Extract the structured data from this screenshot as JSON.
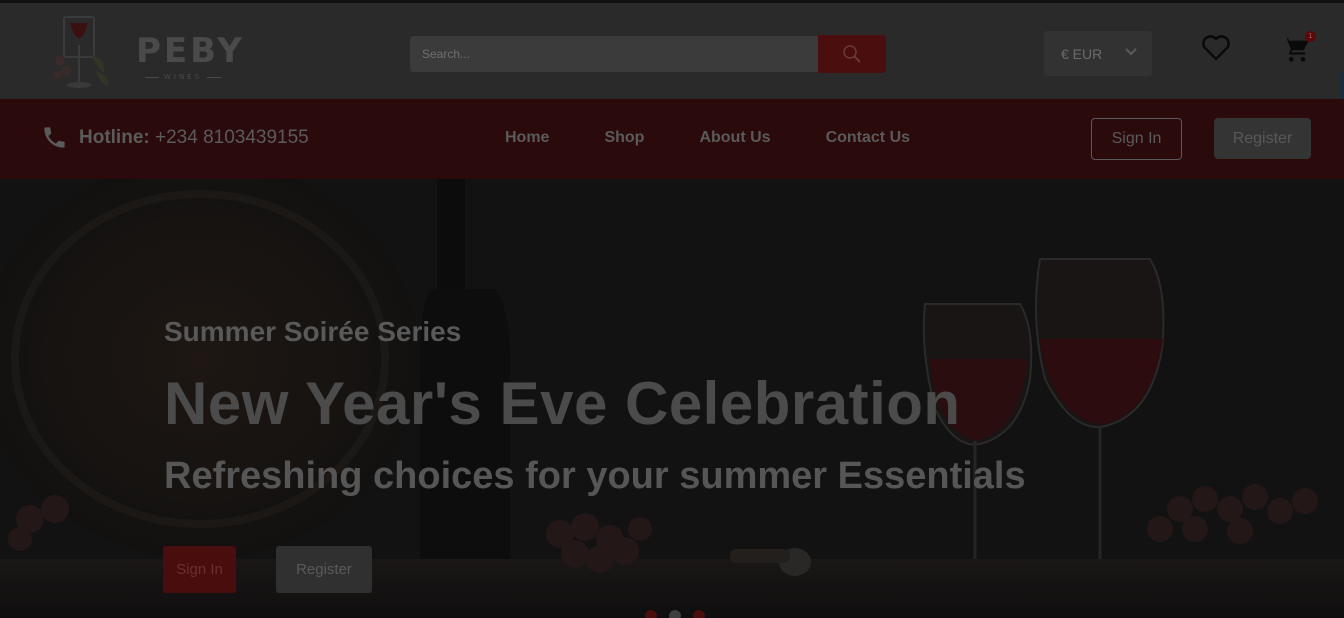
{
  "header": {
    "brand_name": "PEBY",
    "brand_sub": "WINES",
    "search_placeholder": "Search...",
    "currency": "€ EUR",
    "cart_count": "1"
  },
  "nav": {
    "hotline_label": "Hotline:",
    "hotline_number": "+234 8103439155",
    "items": [
      {
        "label": "Home"
      },
      {
        "label": "Shop"
      },
      {
        "label": "About Us"
      },
      {
        "label": "Contact Us"
      }
    ],
    "signin_label": "Sign In",
    "register_label": "Register"
  },
  "hero": {
    "subtitle": "Summer Soirée Series",
    "title": "New Year's Eve Celebration",
    "tagline": "Refreshing choices for your summer Essentials",
    "signin_label": "Sign In",
    "register_label": "Register",
    "slide_dots": [
      "inactive",
      "active",
      "inactive"
    ]
  },
  "colors": {
    "accent": "#4a0d0d",
    "nav_bg": "#2a0a0b",
    "overlay_dim": "#141414"
  },
  "icons": {
    "search": "search-icon",
    "phone": "phone-icon",
    "heart": "heart-icon",
    "cart": "cart-icon",
    "chevron": "chevron-down-icon"
  }
}
